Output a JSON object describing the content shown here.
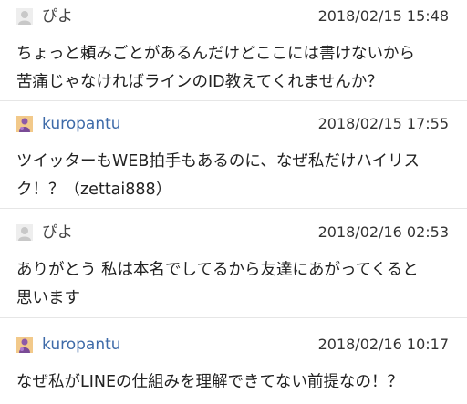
{
  "comments": [
    {
      "user": "ぴよ",
      "avatar_icon": "default-user-icon",
      "timestamp": "2018/02/15 15:48",
      "body": "ちょっと頼みごとがあるんだけどここには書けないから\n苦痛じゃなければラインのID教えてくれませんか？"
    },
    {
      "user": "kuropantu",
      "avatar_icon": "user-profile-icon",
      "timestamp": "2018/02/15 17:55",
      "body": "ツイッターもWEB拍手もあるのに、なぜ私だけハイリス\nク！？（zettai888）"
    },
    {
      "user": "ぴよ",
      "avatar_icon": "default-user-icon",
      "timestamp": "2018/02/16 02:53",
      "body": "ありがとう 私は本名でしてるから友達にあがってくると\n思います"
    },
    {
      "user": "kuropantu",
      "avatar_icon": "user-profile-icon",
      "timestamp": "2018/02/16 10:17",
      "body": "なぜ私がLINEの仕組みを理解できてない前提なの！？"
    }
  ],
  "colors": {
    "username_link": "#3d6aa8",
    "text": "#222222",
    "divider": "#e6e6e6"
  }
}
